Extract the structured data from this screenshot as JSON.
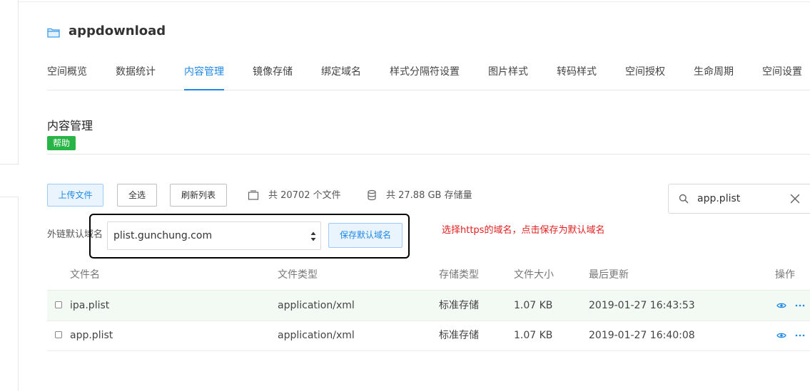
{
  "bucket": {
    "name": "appdownload"
  },
  "tabs": [
    {
      "label": "空间概览"
    },
    {
      "label": "数据统计"
    },
    {
      "label": "内容管理",
      "active": true
    },
    {
      "label": "镜像存储"
    },
    {
      "label": "绑定域名"
    },
    {
      "label": "样式分隔符设置"
    },
    {
      "label": "图片样式"
    },
    {
      "label": "转码样式"
    },
    {
      "label": "空间授权"
    },
    {
      "label": "生命周期"
    },
    {
      "label": "空间设置"
    }
  ],
  "section": {
    "title": "内容管理",
    "help_label": "帮助"
  },
  "toolbar": {
    "upload_label": "上传文件",
    "select_all_label": "全选",
    "refresh_label": "刷新列表",
    "file_count": "共 20702 个文件",
    "storage_total": "共 27.88 GB 存储量"
  },
  "search": {
    "value": "app.plist"
  },
  "domain": {
    "label": "外链默认域名",
    "selected": "plist.gunchung.com",
    "save_label": "保存默认域名"
  },
  "annotation": {
    "note": "选择https的域名，点击保存为默认域名"
  },
  "table": {
    "columns": {
      "name": "文件名",
      "type": "文件类型",
      "storage": "存储类型",
      "size": "文件大小",
      "updated": "最后更新",
      "actions": "操作"
    },
    "rows": [
      {
        "name": "ipa.plist",
        "type": "application/xml",
        "storage": "标准存储",
        "size": "1.07 KB",
        "updated": "2019-01-27 16:43:53"
      },
      {
        "name": "app.plist",
        "type": "application/xml",
        "storage": "标准存储",
        "size": "1.07 KB",
        "updated": "2019-01-27 16:40:08"
      }
    ]
  },
  "colors": {
    "accent": "#1e88e5",
    "help_badge": "#28b446",
    "annotation": "#e02020"
  }
}
